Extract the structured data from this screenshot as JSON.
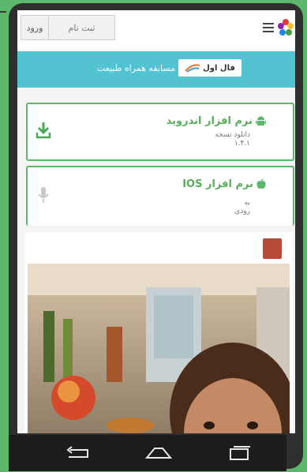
{
  "header": {
    "login_label": "ورود",
    "register_label": "ثبت نام",
    "menu_icon": "hamburger-menu-icon",
    "logo_icon": "star-logo-icon"
  },
  "banner": {
    "brand_name": "فال اول",
    "tagline": "مسابقه همراه طبیعت"
  },
  "downloads": [
    {
      "title": "نرم افزار اندروید",
      "platform_icon": "android-icon",
      "action_icon": "download-icon",
      "line1": "دانلود نسخه",
      "line2": "۱.۴.۱"
    },
    {
      "title": "نرم افزار IOS",
      "platform_icon": "apple-icon",
      "action_icon": "microphone-icon",
      "line1": "به",
      "line2": "زودی"
    }
  ],
  "colors": {
    "background_green": "#5cb86a",
    "banner_cyan": "#53c3d2",
    "title_green": "#59ad5c"
  }
}
